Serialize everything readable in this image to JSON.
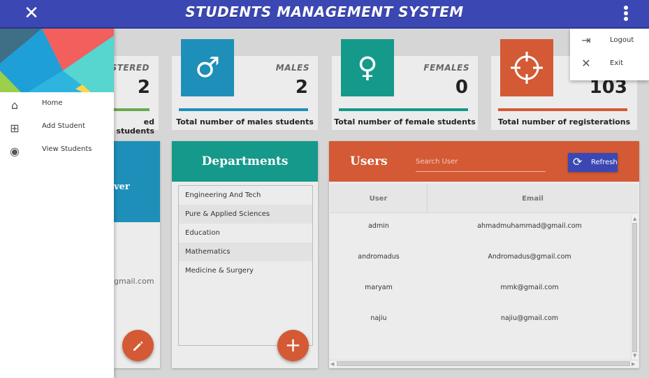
{
  "app": {
    "title": "STUDENTS MANAGEMENT SYSTEM"
  },
  "menu": {
    "items": [
      {
        "label": "Logout",
        "icon": "logout-icon"
      },
      {
        "label": "Exit",
        "icon": "close-icon"
      }
    ]
  },
  "drawer": {
    "items": [
      {
        "label": "Home",
        "icon": "home-icon"
      },
      {
        "label": "Add Student",
        "icon": "add-box-icon"
      },
      {
        "label": "View Students",
        "icon": "eye-icon"
      }
    ]
  },
  "stats": [
    {
      "caption": "ISTERED",
      "value": "2",
      "description": "ed students",
      "color": "#6aa84f"
    },
    {
      "caption": "MALES",
      "value": "2",
      "description": "Total number of males students",
      "color": "#1e8fb8",
      "icon": "male-icon"
    },
    {
      "caption": "FEMALES",
      "value": "0",
      "description": "Total number of female students",
      "color": "#14998a",
      "icon": "female-icon"
    },
    {
      "caption": "",
      "value": "103",
      "description": "Total number of registerations",
      "color": "#d35a35",
      "icon": "crosshair-icon"
    }
  ],
  "profile": {
    "heading_fragment": "ver",
    "email_fragment": "gmail.com"
  },
  "departments": {
    "title": "Departments",
    "items": [
      "Engineering And Tech",
      "Pure & Applied Sciences",
      "Education",
      "Mathematics",
      "Medicine & Surgery"
    ]
  },
  "users": {
    "title": "Users",
    "search_placeholder": "Search User",
    "refresh_label": "Refresh",
    "columns": [
      "User",
      "Email"
    ],
    "rows": [
      {
        "user": "admin",
        "email": "ahmadmuhammad@gmail.com"
      },
      {
        "user": "andromadus",
        "email": "Andromadus@gmail.com"
      },
      {
        "user": "maryam",
        "email": "mmk@gmail.com"
      },
      {
        "user": "najiu",
        "email": "najiu@gmail.com"
      }
    ]
  },
  "colors": {
    "primary": "#3b48b3",
    "accent": "#d35a35",
    "teal": "#14998a",
    "blue": "#1e8fb8"
  }
}
